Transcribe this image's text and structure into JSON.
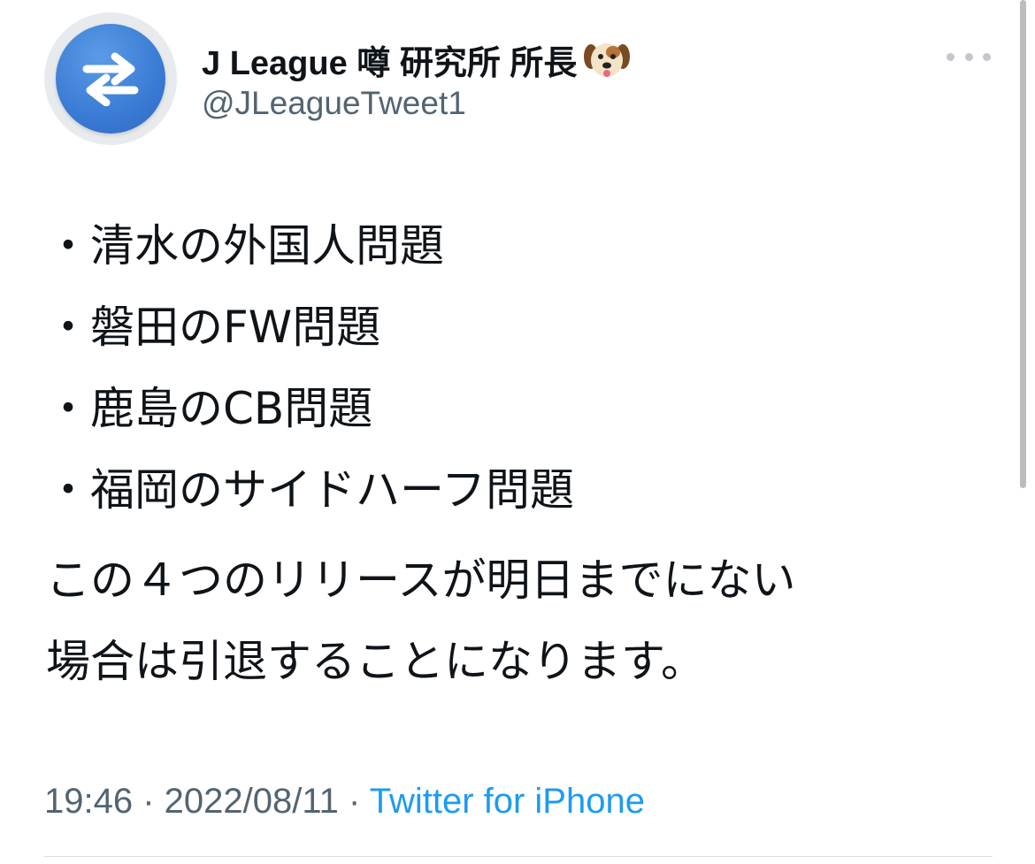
{
  "tweet": {
    "author": {
      "display_name": "J League 噂 研究所 所長",
      "emoji": "dog-face-emoji",
      "handle": "@JLeagueTweet1",
      "avatar_icon": "swap-arrows-icon"
    },
    "more_icon": "more-options-icon",
    "bullets": [
      "・清水の外国人問題",
      "・磐田のFW問題",
      "・鹿島のCB問題",
      "・福岡のサイドハーフ問題"
    ],
    "paragraph_lines": [
      "この４つのリリースが明日までにない",
      "場合は引退することになります。"
    ],
    "time": "19:46",
    "separator": " · ",
    "date": "2022/08/11",
    "source": "Twitter for iPhone"
  },
  "colors": {
    "avatar_blue": "#3a7bd5",
    "text_primary": "#0f1419",
    "text_secondary": "#536471",
    "link": "#1d9bf0"
  }
}
